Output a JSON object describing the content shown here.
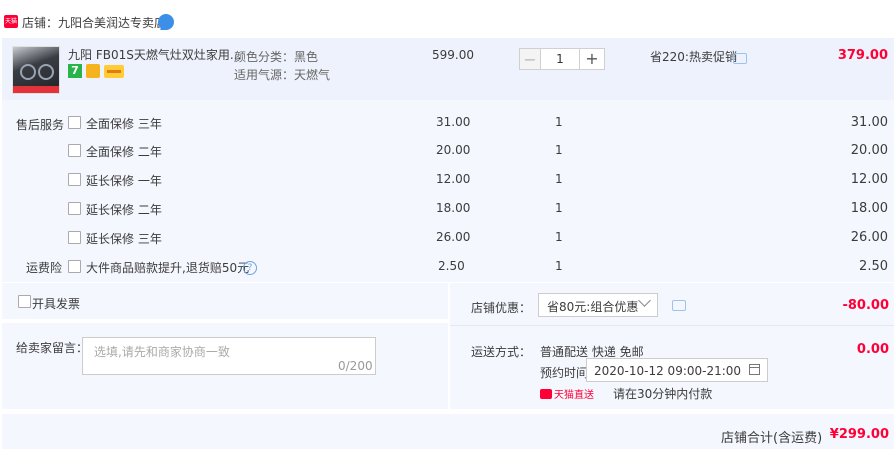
{
  "shop": {
    "name": "店铺：九阳合美润达专卖店"
  },
  "product": {
    "title": "九阳 FB01S天燃气灶双灶家用...",
    "sku_color": "颜色分类：黑色",
    "sku_gas": "适用气源：天燃气",
    "unit_price": "599.00",
    "quantity": "1",
    "promo": "省220:热卖促销",
    "subtotal": "379.00"
  },
  "services": {
    "title": "售后服务",
    "items": [
      {
        "label": "全面保修 三年",
        "price": "31.00",
        "qty": "1",
        "total": "31.00"
      },
      {
        "label": "全面保修 二年",
        "price": "20.00",
        "qty": "1",
        "total": "20.00"
      },
      {
        "label": "延长保修 一年",
        "price": "12.00",
        "qty": "1",
        "total": "12.00"
      },
      {
        "label": "延长保修 二年",
        "price": "18.00",
        "qty": "1",
        "total": "18.00"
      },
      {
        "label": "延长保修 三年",
        "price": "26.00",
        "qty": "1",
        "total": "26.00"
      }
    ]
  },
  "freight_insurance": {
    "title": "运费险",
    "label": "大件商品赔款提升,退货赔50元",
    "price": "2.50",
    "qty": "1",
    "total": "2.50"
  },
  "invoice": {
    "label": "开具发票"
  },
  "message": {
    "label": "给卖家留言：",
    "placeholder": "选填,请先和商家协商一致",
    "count": "0/200"
  },
  "coupon": {
    "label": "店铺优惠：",
    "selected": "省80元:组合优惠",
    "amount": "-80.00"
  },
  "shipping": {
    "label": "运送方式：",
    "methods": "普通配送 快递 免邮",
    "amount": "0.00",
    "appointment_label": "预约时间",
    "appointment_value": "2020-10-12 09:00-21:00",
    "express_name": "天猫直送",
    "express_note": "请在30分钟内付款"
  },
  "footer": {
    "total_label": "店铺合计(含运费)",
    "total_amount": "¥299.00"
  },
  "colors": {
    "accent": "#ff0036",
    "panel": "#f4f7fe",
    "link": "#3d8ee6"
  }
}
